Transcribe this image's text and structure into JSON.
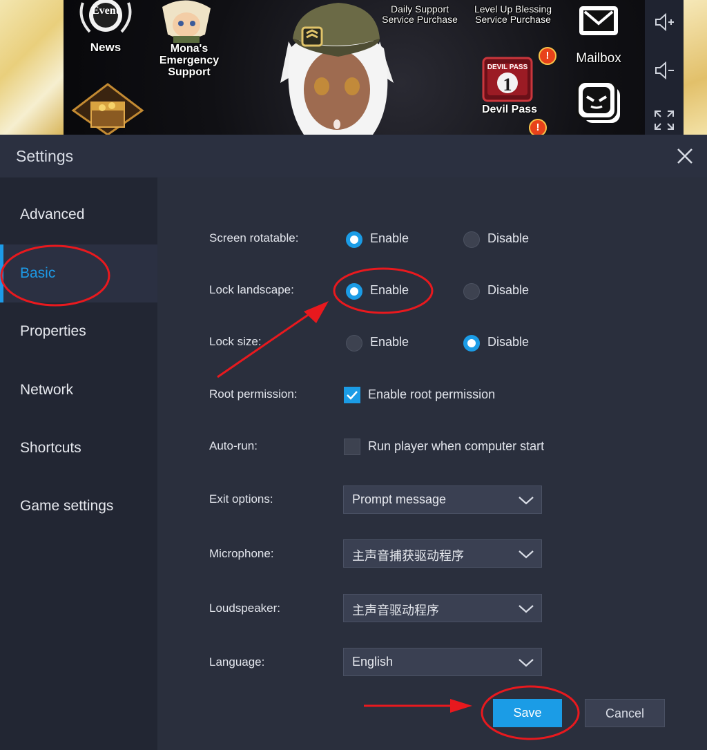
{
  "game": {
    "news_label": "News",
    "news_badge_text": "Event",
    "mona_label": "Mona's Emergency Support",
    "daily_support_label": "Daily Support Service Purchase",
    "levelup_label": "Level Up Blessing Service Purchase",
    "mailbox_label": "Mailbox",
    "devil_pass_label": "Devil Pass",
    "devil_pass_badge": "DEVIL PASS",
    "devil_pass_level": "1",
    "alert_glyph": "!"
  },
  "dialog": {
    "title": "Settings",
    "close_glyph": "✕"
  },
  "nav": {
    "items": [
      {
        "label": "Advanced"
      },
      {
        "label": "Basic"
      },
      {
        "label": "Properties"
      },
      {
        "label": "Network"
      },
      {
        "label": "Shortcuts"
      },
      {
        "label": "Game settings"
      }
    ],
    "active_index": 1
  },
  "settings": {
    "screen_rotatable": {
      "label": "Screen rotatable:",
      "enable": "Enable",
      "disable": "Disable",
      "selected": "Enable"
    },
    "lock_landscape": {
      "label": "Lock landscape:",
      "enable": "Enable",
      "disable": "Disable",
      "selected": "Enable"
    },
    "lock_size": {
      "label": "Lock size:",
      "enable": "Enable",
      "disable": "Disable",
      "selected": "Disable"
    },
    "root_permission": {
      "label": "Root permission:",
      "option": "Enable root permission",
      "checked": true
    },
    "auto_run": {
      "label": "Auto-run:",
      "option": "Run player when computer start",
      "checked": false
    },
    "exit_options": {
      "label": "Exit options:",
      "value": "Prompt message"
    },
    "microphone": {
      "label": "Microphone:",
      "value": "主声音捕获驱动程序"
    },
    "loudspeaker": {
      "label": "Loudspeaker:",
      "value": "主声音驱动程序"
    },
    "language": {
      "label": "Language:",
      "value": "English"
    }
  },
  "buttons": {
    "save": "Save",
    "cancel": "Cancel"
  },
  "colors": {
    "accent": "#1b9ce6",
    "annotation": "#e8191e",
    "dialog_bg": "#2a2f3d",
    "nav_bg": "#222633"
  },
  "icons": {
    "volume_up": "volume-up-icon",
    "volume_down": "volume-down-icon",
    "fullscreen": "fullscreen-icon",
    "mailbox": "envelope-icon",
    "chevron": "chevron-down-icon",
    "close": "close-icon",
    "check": "checkmark-icon"
  }
}
